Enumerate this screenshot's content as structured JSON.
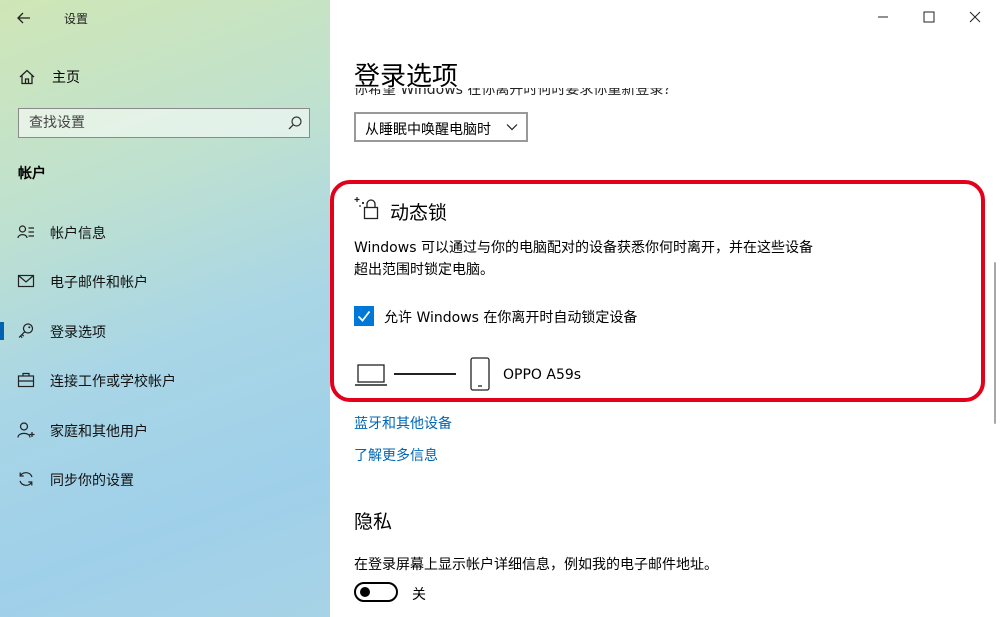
{
  "window": {
    "title": "设置"
  },
  "sidebar": {
    "home_label": "主页",
    "search_placeholder": "查找设置",
    "section_title": "帐户",
    "items": [
      {
        "label": "帐户信息",
        "icon": "person-card-icon"
      },
      {
        "label": "电子邮件和帐户",
        "icon": "mail-icon"
      },
      {
        "label": "登录选项",
        "icon": "key-icon",
        "selected": true
      },
      {
        "label": "连接工作或学校帐户",
        "icon": "briefcase-icon"
      },
      {
        "label": "家庭和其他用户",
        "icon": "person-add-icon"
      },
      {
        "label": "同步你的设置",
        "icon": "sync-icon"
      }
    ]
  },
  "main": {
    "page_title": "登录选项",
    "clipped_text": "你希望 Windows 在你离开时何时要求你重新登录？",
    "wake_dropdown": {
      "value": "从睡眠中唤醒电脑时"
    },
    "dynamic_lock": {
      "title": "动态锁",
      "description": "Windows 可以通过与你的电脑配对的设备获悉你何时离开，并在这些设备超出范围时锁定电脑。",
      "checkbox_label": "允许 Windows 在你离开时自动锁定设备",
      "checkbox_checked": true,
      "device_name": "OPPO A59s"
    },
    "links": {
      "bluetooth": "蓝牙和其他设备",
      "learn_more": "了解更多信息"
    },
    "privacy": {
      "title": "隐私",
      "description": "在登录屏幕上显示帐户详细信息，例如我的电子邮件地址。",
      "toggle_label": "关",
      "toggle_on": false
    }
  },
  "colors": {
    "accent": "#0078d7",
    "link": "#0066b4",
    "highlight_border": "#e3001b"
  }
}
